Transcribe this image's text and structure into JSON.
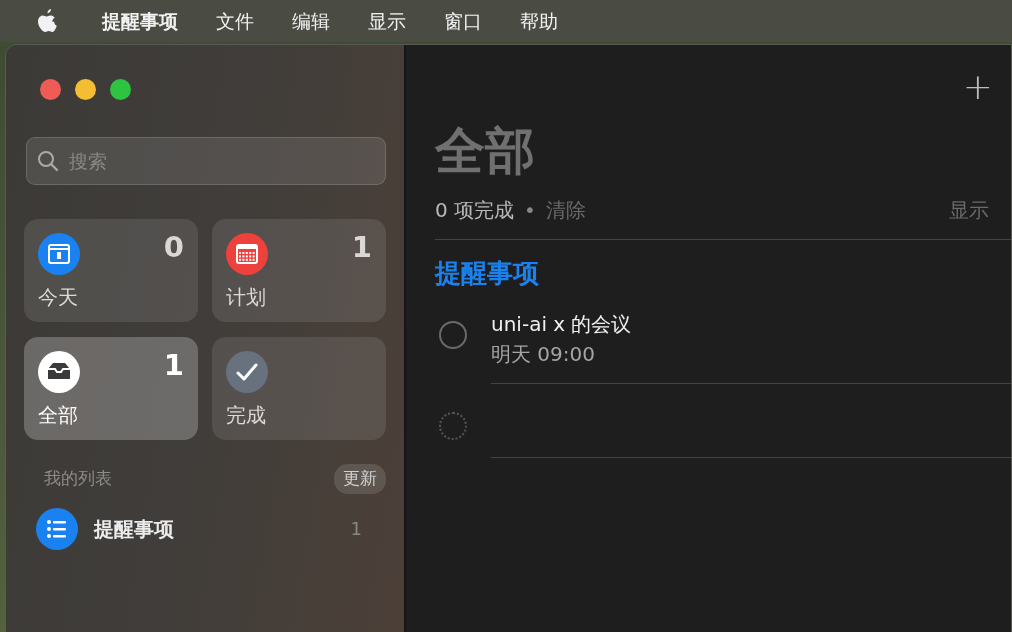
{
  "menu_bar": [
    {
      "kind": "apple"
    },
    {
      "kind": "app",
      "label": "提醒事项"
    },
    {
      "kind": "menu",
      "label": "文件"
    },
    {
      "kind": "menu",
      "label": "编辑"
    },
    {
      "kind": "menu",
      "label": "显示"
    },
    {
      "kind": "menu",
      "label": "窗口"
    },
    {
      "kind": "menu",
      "label": "帮助"
    }
  ],
  "sidebar": {
    "search": {
      "placeholder": "搜索"
    },
    "smart_lists": [
      {
        "kind": "today",
        "label": "今天",
        "count": "0",
        "color": "#1a82f0",
        "selected": false
      },
      {
        "kind": "scheduled",
        "label": "计划",
        "count": "1",
        "color": "#ee413d",
        "selected": false
      },
      {
        "kind": "all",
        "label": "全部",
        "count": "1",
        "color": "#ffffff",
        "selected": true
      },
      {
        "kind": "completed",
        "label": "完成",
        "color": "#68727f",
        "selected": false
      }
    ],
    "my_lists_header": "我的列表",
    "update_button": "更新",
    "lists": [
      {
        "label": "提醒事项",
        "count": "1",
        "color": "#1a82f0"
      }
    ]
  },
  "main": {
    "add_button": "+",
    "title": "全部",
    "summary": "0 项完成",
    "separator": "•",
    "clear": "清除",
    "show": "显示",
    "section": {
      "title": "提醒事项",
      "color": "#1a82f0"
    },
    "reminders": [
      {
        "kind": "item",
        "title": "uni-ai x 的会议",
        "due": "明天 09:00",
        "completed": false
      },
      {
        "kind": "new",
        "completed": false
      }
    ]
  }
}
